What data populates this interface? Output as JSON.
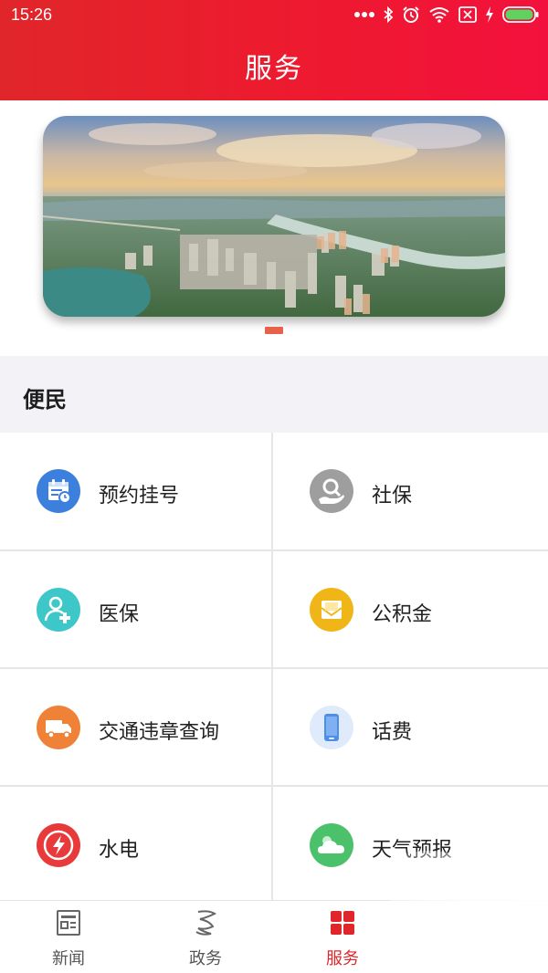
{
  "status_bar": {
    "time": "15:26",
    "icons": [
      "more-dots-icon",
      "bluetooth-icon",
      "alarm-icon",
      "wifi-icon",
      "sim-off-icon",
      "charging-icon",
      "battery-icon"
    ]
  },
  "header": {
    "title": "服务"
  },
  "banner": {
    "image": "city-aerial-photo",
    "indicator_count": 1,
    "active_index": 0
  },
  "section": {
    "title": "便民"
  },
  "services": [
    {
      "label": "预约挂号",
      "icon": "calendar-icon",
      "color": "#3d7fdc"
    },
    {
      "label": "社保",
      "icon": "social-security-icon",
      "color": "#9e9e9e"
    },
    {
      "label": "医保",
      "icon": "medical-insurance-icon",
      "color": "#3ec7c9"
    },
    {
      "label": "公积金",
      "icon": "provident-fund-icon",
      "color": "#f0b617"
    },
    {
      "label": "交通违章查询",
      "icon": "truck-icon",
      "color": "#f08238"
    },
    {
      "label": "话费",
      "icon": "phone-icon",
      "color": "#4f8ee6"
    },
    {
      "label": "水电",
      "icon": "lightning-icon",
      "color": "#e83a3a"
    },
    {
      "label": "天气预报",
      "icon": "weather-cloud-icon",
      "color": "#4cc16c"
    }
  ],
  "bottom_nav": {
    "items": [
      {
        "label": "新闻",
        "icon": "news-icon",
        "active": false
      },
      {
        "label": "政务",
        "icon": "government-icon",
        "active": false
      },
      {
        "label": "服务",
        "icon": "service-grid-icon",
        "active": true
      }
    ],
    "active_color": "#e0262a"
  }
}
